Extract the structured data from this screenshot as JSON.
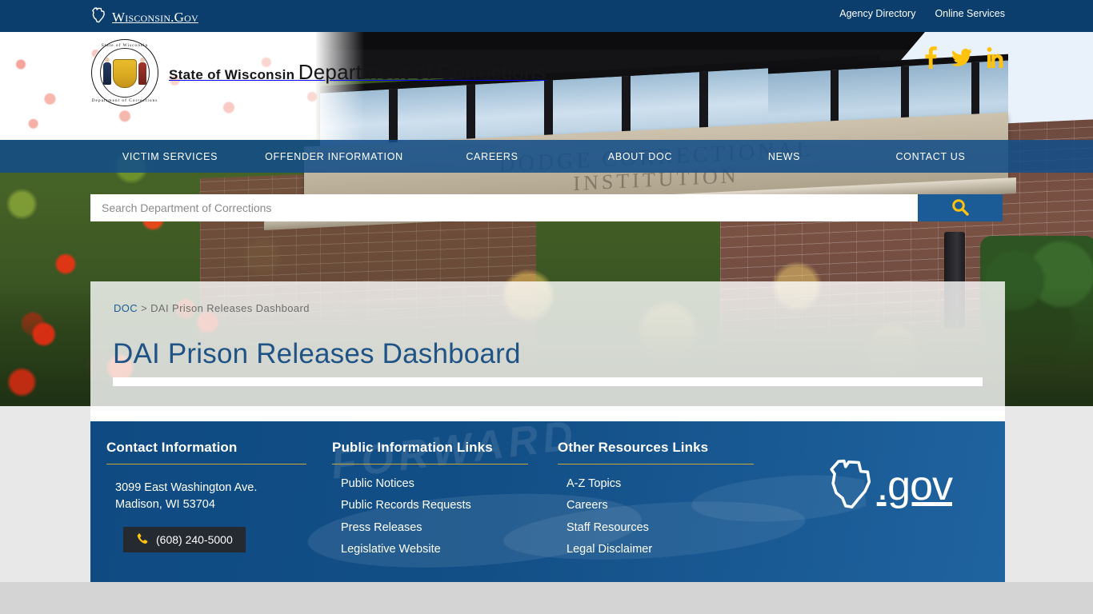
{
  "topbar": {
    "brand": "Wisconsin.Gov",
    "links": [
      {
        "label": "Agency Directory"
      },
      {
        "label": "Online Services"
      }
    ]
  },
  "header": {
    "agency_line1": "State of Wisconsin",
    "agency_line2": "Department of Corrections",
    "seal_arc_top": "State of Wisconsin",
    "seal_arc_bottom": "Department of Corrections",
    "social": [
      {
        "name": "facebook-icon",
        "label": "Facebook"
      },
      {
        "name": "twitter-icon",
        "label": "Twitter"
      },
      {
        "name": "linkedin-icon",
        "label": "LinkedIn"
      }
    ],
    "social_color": "#ffc20e"
  },
  "nav": {
    "items": [
      {
        "label": "VICTIM SERVICES"
      },
      {
        "label": "OFFENDER INFORMATION"
      },
      {
        "label": "CAREERS"
      },
      {
        "label": "ABOUT DOC"
      },
      {
        "label": "NEWS"
      },
      {
        "label": "CONTACT US"
      }
    ]
  },
  "search": {
    "placeholder": "Search Department of Corrections",
    "value": "",
    "button_icon": "search-icon",
    "button_color": "#1b5c96",
    "icon_color": "#ffc20e"
  },
  "hero": {
    "building_engraving_line1": "DODGE CORRECTIONAL",
    "building_engraving_line2": "INSTITUTION"
  },
  "content": {
    "breadcrumb_root": "DOC",
    "breadcrumb_separator": ">",
    "breadcrumb_current": "DAI Prison Releases Dashboard",
    "title": "DAI Prison Releases Dashboard",
    "title_color": "#1f5285"
  },
  "footer": {
    "watermark": "FORWARD",
    "columns": [
      {
        "heading": "Contact Information",
        "address_line1": "3099 East Washington Ave.",
        "address_line2": "Madison, WI 53704",
        "phone": "(608) 240-5000",
        "phone_icon": "phone-icon"
      },
      {
        "heading": "Public Information Links",
        "links": [
          {
            "label": "Public Notices"
          },
          {
            "label": "Public Records Requests"
          },
          {
            "label": "Press Releases"
          },
          {
            "label": "Legislative Website"
          }
        ]
      },
      {
        "heading": "Other Resources Links",
        "links": [
          {
            "label": "A-Z Topics"
          },
          {
            "label": "Careers"
          },
          {
            "label": "Staff Resources"
          },
          {
            "label": "Legal Disclaimer"
          }
        ]
      }
    ],
    "wigov_suffix": ".gov",
    "accent_rule_color": "#c8a93a",
    "background_color": "#134f87"
  }
}
